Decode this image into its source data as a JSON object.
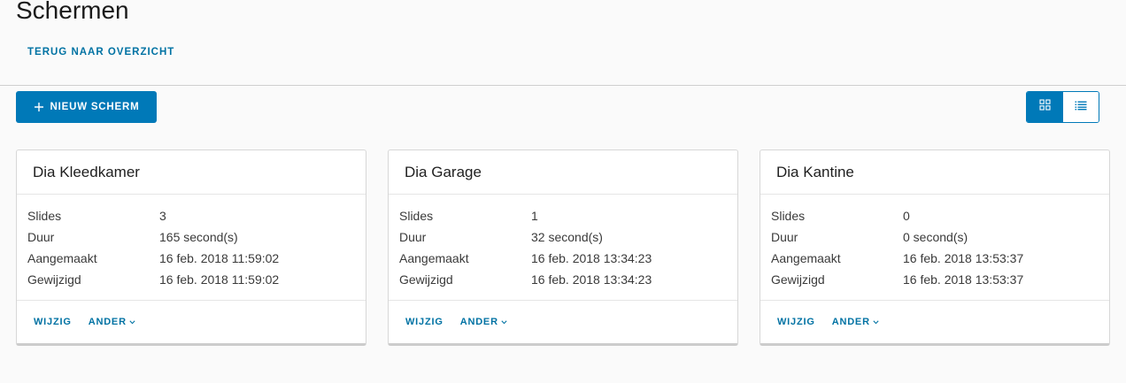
{
  "page": {
    "title": "Schermen",
    "back_link": "TERUG NAAR OVERZICHT"
  },
  "toolbar": {
    "new_button_label": "NIEUW SCHERM",
    "accent_color": "#0079b8",
    "view_mode": "grid"
  },
  "labels": {
    "slides": "Slides",
    "duration": "Duur",
    "created": "Aangemaakt",
    "modified": "Gewijzigd",
    "edit": "WIJZIG",
    "other": "ANDER"
  },
  "screens": [
    {
      "name": "Dia Kleedkamer",
      "slides": "3",
      "duration": "165 second(s)",
      "created": "16 feb. 2018 11:59:02",
      "modified": "16 feb. 2018 11:59:02"
    },
    {
      "name": "Dia Garage",
      "slides": "1",
      "duration": "32 second(s)",
      "created": "16 feb. 2018 13:34:23",
      "modified": "16 feb. 2018 13:34:23"
    },
    {
      "name": "Dia Kantine",
      "slides": "0",
      "duration": "0 second(s)",
      "created": "16 feb. 2018 13:53:37",
      "modified": "16 feb. 2018 13:53:37"
    }
  ]
}
